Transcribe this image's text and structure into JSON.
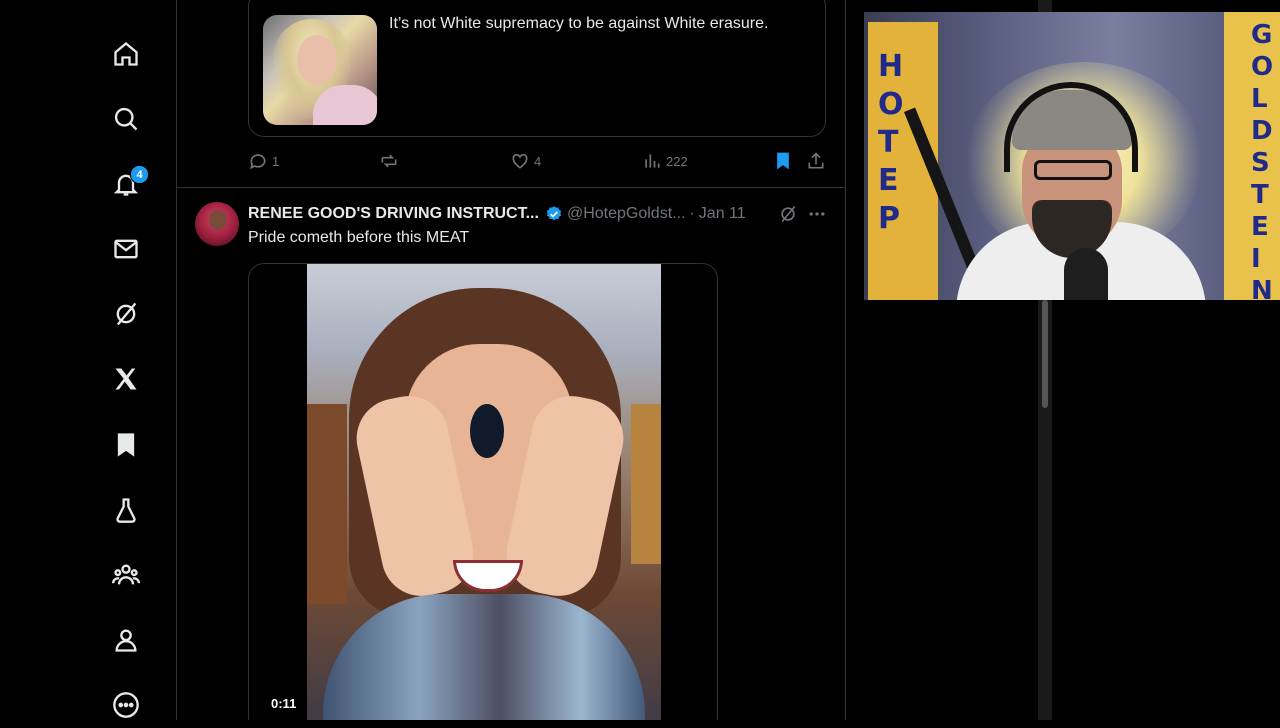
{
  "nav": {
    "notifications_badge": "4",
    "items": [
      "home-icon",
      "search-icon",
      "bell-icon",
      "mail-icon",
      "grok-icon",
      "x-logo-icon",
      "bookmark-icon",
      "flask-icon",
      "communities-icon",
      "profile-icon",
      "more-circle-icon"
    ]
  },
  "quote_post": {
    "text": "It’s not White supremacy to be against White erasure."
  },
  "actions": {
    "replies": "1",
    "reposts": "",
    "likes": "4",
    "views": "222"
  },
  "post": {
    "author": "RENEE GOOD'S DRIVING INSTRUCT...",
    "handle": "@HotepGoldst...",
    "dot": "·",
    "date": "Jan 11",
    "text": "Pride cometh before this MEAT",
    "video_duration": "0:11"
  },
  "webcam": {
    "left_flag_letters": [
      "H",
      "O",
      "T",
      "E",
      "P"
    ],
    "right_flag_letters": [
      "G",
      "O",
      "L",
      "D",
      "S",
      "T",
      "E",
      "I",
      "N"
    ]
  },
  "colors": {
    "accent": "#1d9bf0",
    "muted": "#71767b",
    "border": "#2f3336",
    "text": "#e7e9ea"
  }
}
